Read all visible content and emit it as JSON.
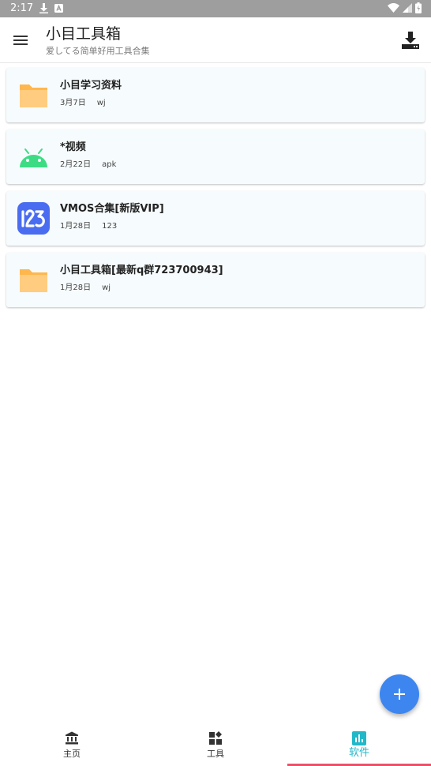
{
  "status_bar": {
    "time": "2:17"
  },
  "app_bar": {
    "title": "小目工具箱",
    "subtitle": "爱してる简单好用工具合集"
  },
  "files": [
    {
      "name": "小目学习资料",
      "date": "3月7日",
      "tag": "wj",
      "icon": "folder-icon"
    },
    {
      "name": "*视频",
      "date": "2月22日",
      "tag": "apk",
      "icon": "android-icon"
    },
    {
      "name": "VMOS合集[新版VIP]",
      "date": "1月28日",
      "tag": "123",
      "icon": "pan123-icon"
    },
    {
      "name": "小目工具箱[最新q群723700943]",
      "date": "1月28日",
      "tag": "wj",
      "icon": "folder-icon"
    }
  ],
  "bottom_nav": {
    "items": [
      {
        "label": "主页",
        "icon": "bank-icon"
      },
      {
        "label": "工具",
        "icon": "widgets-icon"
      },
      {
        "label": "软件",
        "icon": "chart-icon"
      }
    ],
    "active_index": 2
  },
  "colors": {
    "accent": "#22b8c8",
    "fab": "#3d86f0",
    "indicator": "#e8526a",
    "folder": "#ffc773",
    "android": "#3ddc84",
    "pan123": "#4a6cf0"
  }
}
